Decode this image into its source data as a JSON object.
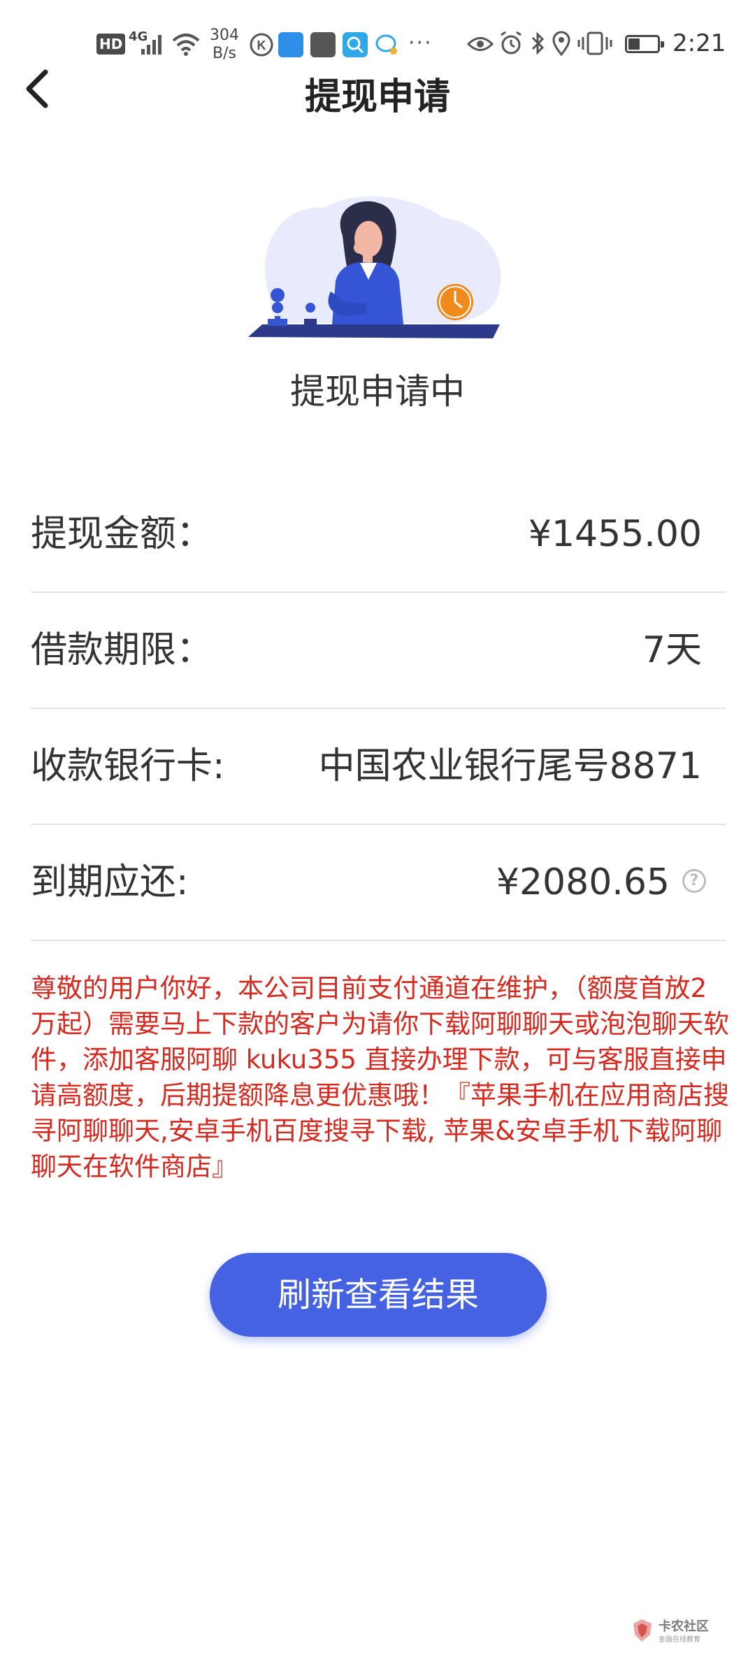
{
  "status_bar": {
    "hd_badge": "HD",
    "network": "4G",
    "speed_value": "304",
    "speed_unit": "B/s",
    "more": "···",
    "time": "2:21",
    "icons": [
      "signal-icon",
      "wifi-icon",
      "app-k-icon",
      "app-blue-icon",
      "app-huawei-icon",
      "app-search-icon",
      "app-chat-icon",
      "eye-icon",
      "alarm-icon",
      "bluetooth-icon",
      "location-icon",
      "vibrate-icon",
      "battery-icon"
    ]
  },
  "header": {
    "title": "提现申请"
  },
  "status": {
    "text": "提现申请中"
  },
  "details": [
    {
      "label": "提现金额：",
      "value": "¥1455.00"
    },
    {
      "label": "借款期限：",
      "value": "7天"
    },
    {
      "label": "收款银行卡:",
      "value": "中国农业银行尾号8871"
    },
    {
      "label": "到期应还:",
      "value": "¥2080.65",
      "help": "?"
    }
  ],
  "notice": "尊敬的用户你好，本公司目前支付通道在维护，（额度首放2万起）需要马上下款的客户为请你下载阿聊聊天或泡泡聊天软件，添加客服阿聊 kuku355 直接办理下款，可与客服直接申请高额度，后期提额降息更优惠哦！『苹果手机在应用商店搜寻阿聊聊天,安卓手机百度搜寻下载, 苹果&安卓手机下载阿聊聊天在软件商店』",
  "button": {
    "label": "刷新查看结果"
  },
  "watermark": {
    "text": "卡农社区",
    "sub": "金融在线教育"
  },
  "colors": {
    "accent": "#4562e2",
    "notice": "#d42a20",
    "clock": "#f08a1c"
  }
}
